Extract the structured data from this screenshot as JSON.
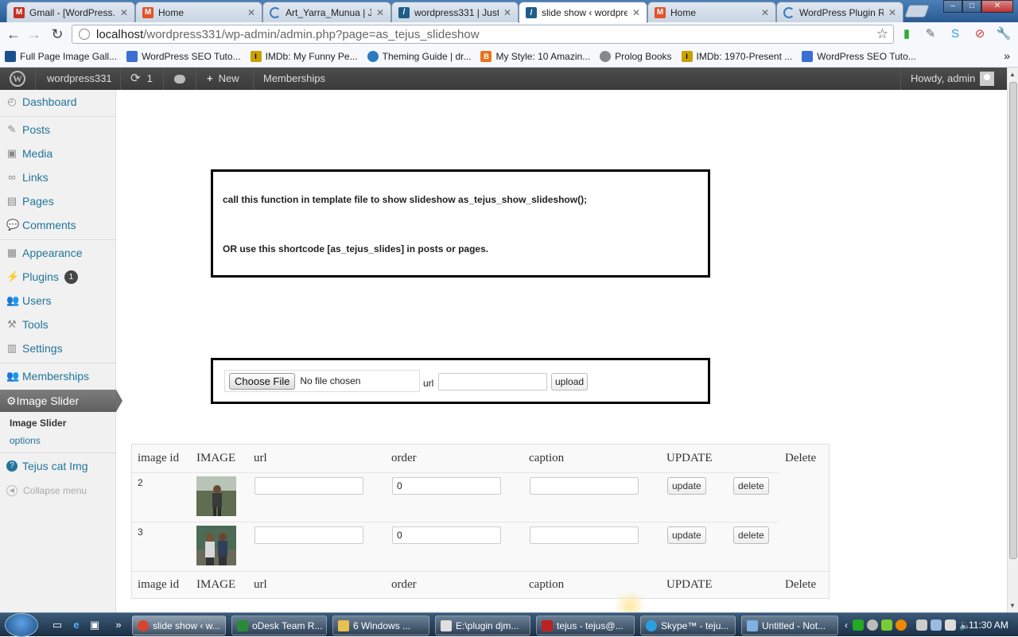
{
  "browser": {
    "tabs": [
      {
        "title": "Gmail - [WordPress.o",
        "icon": "gmail-icon",
        "color": "#c23321"
      },
      {
        "title": "Home",
        "icon": "magento-icon",
        "color": "#e0542b"
      },
      {
        "title": "Art_Yarra_Munua | Ju",
        "icon": "loading-icon",
        "color": "#3b7bc0"
      },
      {
        "title": "wordpress331 | Just a",
        "icon": "wordpress-icon",
        "color": "#1e5d8a"
      },
      {
        "title": "slide show ‹ wordpre",
        "icon": "wordpress-icon",
        "color": "#1e5d8a"
      },
      {
        "title": "Home",
        "icon": "magento-icon",
        "color": "#e0542b"
      },
      {
        "title": "WordPress Plugin Re",
        "icon": "loading-icon",
        "color": "#3b7bc0"
      }
    ],
    "url_host": "localhost",
    "url_path": "/wordpress331/wp-admin/admin.php?page=as_tejus_slideshow",
    "bookmarks": [
      {
        "label": "Full Page Image Gall...",
        "color": "#1a4f8c"
      },
      {
        "label": "WordPress SEO Tuto...",
        "color": "#3b6fd4"
      },
      {
        "label": "IMDb: My Funny Pe...",
        "color": "#c8a000"
      },
      {
        "label": "Theming Guide | dr...",
        "color": "#2a7ac0"
      },
      {
        "label": "My Style: 10 Amazin...",
        "color": "#e8741e"
      },
      {
        "label": "Prolog Books",
        "color": "#888888"
      },
      {
        "label": "IMDb: 1970-Present ...",
        "color": "#c8a000"
      },
      {
        "label": "WordPress SEO Tuto...",
        "color": "#3b6fd4"
      }
    ]
  },
  "adminbar": {
    "site": "wordpress331",
    "updates": "1",
    "new": "New",
    "memberships": "Memberships",
    "howdy": "Howdy, admin"
  },
  "sidebar": {
    "dashboard": "Dashboard",
    "posts": "Posts",
    "media": "Media",
    "links": "Links",
    "pages": "Pages",
    "comments": "Comments",
    "appearance": "Appearance",
    "plugins": "Plugins",
    "plugins_badge": "1",
    "users": "Users",
    "tools": "Tools",
    "settings": "Settings",
    "memberships": "Memberships",
    "image_slider": "Image Slider",
    "sub_image_slider": "Image Slider",
    "sub_options": "options",
    "tejus_cat": "Tejus cat Img",
    "collapse": "Collapse menu"
  },
  "info": {
    "line1": "call this function in template file to show slideshow as_tejus_show_slideshow();",
    "line2": "OR use this shortcode [as_tejus_slides] in posts or pages."
  },
  "upload": {
    "choose_label": "Choose File",
    "no_file": "No file chosen",
    "url_label": "url",
    "url_value": "",
    "upload_label": "upload"
  },
  "table": {
    "headers": [
      "image id",
      "IMAGE",
      "url",
      "order",
      "caption",
      "UPDATE",
      "Delete"
    ],
    "rows": [
      {
        "id": "2",
        "url": "",
        "order": "0",
        "caption": "",
        "update": "update",
        "delete": "delete"
      },
      {
        "id": "3",
        "url": "",
        "order": "0",
        "caption": "",
        "update": "update",
        "delete": "delete"
      }
    ]
  },
  "taskbar": {
    "tasks": [
      {
        "label": "slide show ‹ w...",
        "color": "#d9442e"
      },
      {
        "label": "oDesk Team R...",
        "color": "#2a8a3a"
      },
      {
        "label": "6 Windows ...",
        "color": "#e8c050"
      },
      {
        "label": "E:\\plugin djm...",
        "color": "#e0e0e0"
      },
      {
        "label": "tejus - tejus@...",
        "color": "#b22"
      },
      {
        "label": "Skype™ - teju...",
        "color": "#2aa0e0"
      },
      {
        "label": "Untitled - Not...",
        "color": "#7fb0e0"
      }
    ],
    "clock": "11:30 AM"
  },
  "colors": {
    "wp_link": "#21759b",
    "adminbar": "#464646",
    "sidebar_bg": "#f1f1f1"
  }
}
